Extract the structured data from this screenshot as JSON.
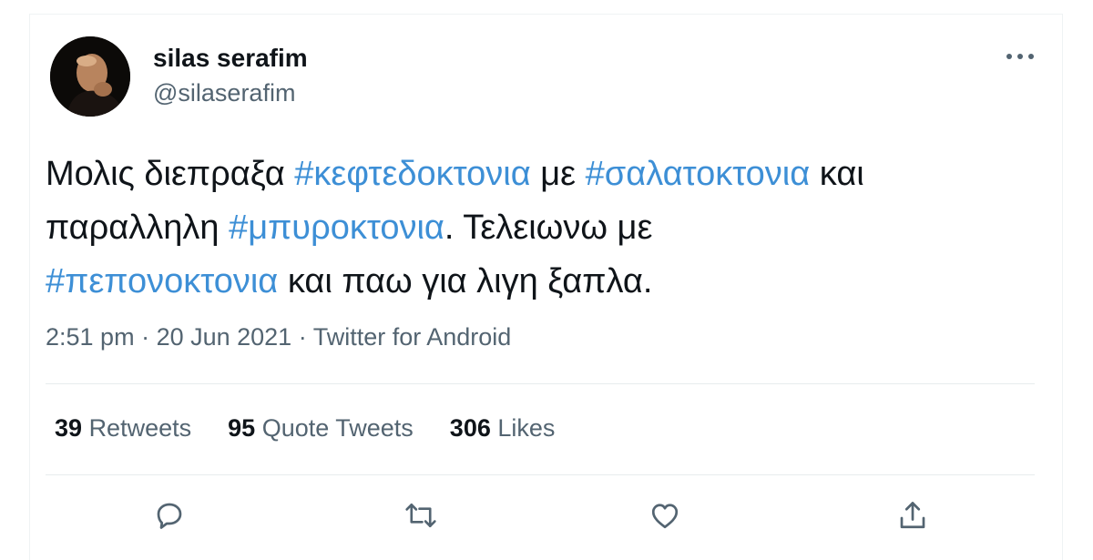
{
  "user": {
    "display_name": "silas serafim",
    "handle": "@silaserafim"
  },
  "tweet": {
    "line1": {
      "t1": "Μολις διεπραξα ",
      "h1": "#κεφτεδοκτονια",
      "t2": " με ",
      "h2": "#σαλατοκτονια",
      "t3": " και"
    },
    "line2": {
      "t1": "παραλληλη ",
      "h1": "#μπυροκτονια",
      "t2": ". Τελειωνω με"
    },
    "line3": {
      "h1": "#πεπονοκτονια",
      "t1": " και παω για λιγη ξαπλα."
    }
  },
  "meta": {
    "time": "2:51 pm",
    "sep1": " · ",
    "date": "20 Jun 2021",
    "sep2": " · ",
    "source": "Twitter for Android"
  },
  "stats": {
    "retweets_count": "39",
    "retweets_label": "Retweets",
    "quotes_count": "95",
    "quotes_label": "Quote Tweets",
    "likes_count": "306",
    "likes_label": "Likes"
  },
  "colors": {
    "link": "#3d8fd6",
    "secondary_text": "#536471",
    "primary_text": "#0f1419"
  },
  "icons": {
    "more": "more-dots-icon",
    "reply": "reply-bubble-icon",
    "retweet": "retweet-arrows-icon",
    "like": "heart-icon",
    "share": "share-upload-icon"
  }
}
